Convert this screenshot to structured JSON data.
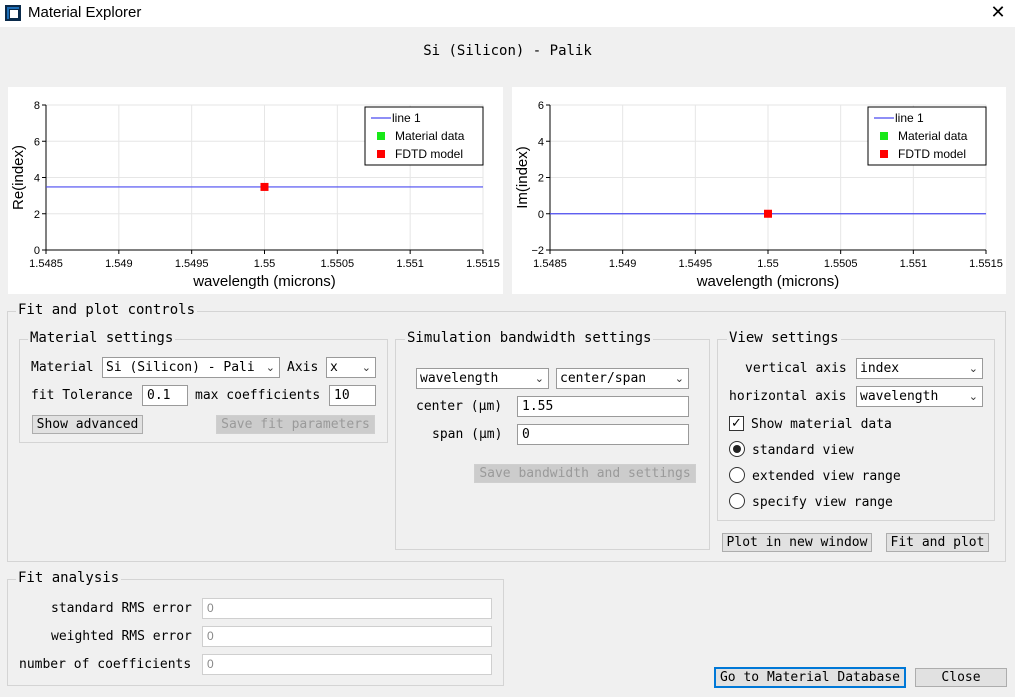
{
  "window": {
    "title": "Material Explorer",
    "close_icon": "close-icon",
    "app_icon": "material-explorer-icon"
  },
  "plot_title": "Si (Silicon) - Palik",
  "chart_data": [
    {
      "type": "line",
      "xlabel": "wavelength (microns)",
      "ylabel": "Re(index)",
      "xlim": [
        1.5485,
        1.5515
      ],
      "ylim": [
        0,
        8
      ],
      "x_ticks": [
        "1.5485",
        "1.549",
        "1.5495",
        "1.55",
        "1.5505",
        "1.551",
        "1.5515"
      ],
      "y_ticks": [
        "0",
        "2",
        "4",
        "6",
        "8"
      ],
      "grid": true,
      "legend": {
        "placement": "top-right",
        "entries": [
          "line 1",
          "Material data",
          "FDTD model"
        ]
      },
      "series": [
        {
          "name": "line 1",
          "x": [
            1.5485,
            1.5515
          ],
          "y": [
            3.48,
            3.48
          ],
          "color": "#4a4af0"
        },
        {
          "name": "Material data",
          "x": [],
          "y": [],
          "color": "#18e818"
        },
        {
          "name": "FDTD model",
          "x": [
            1.55
          ],
          "y": [
            3.48
          ],
          "color": "#ff0000"
        }
      ]
    },
    {
      "type": "line",
      "xlabel": "wavelength (microns)",
      "ylabel": "Im(index)",
      "xlim": [
        1.5485,
        1.5515
      ],
      "ylim": [
        -2,
        6
      ],
      "x_ticks": [
        "1.5485",
        "1.549",
        "1.5495",
        "1.55",
        "1.5505",
        "1.551",
        "1.5515"
      ],
      "y_ticks": [
        "−2",
        "0",
        "2",
        "4",
        "6"
      ],
      "grid": true,
      "legend": {
        "placement": "top-right",
        "entries": [
          "line 1",
          "Material data",
          "FDTD model"
        ]
      },
      "series": [
        {
          "name": "line 1",
          "x": [
            1.5485,
            1.5515
          ],
          "y": [
            0,
            0
          ],
          "color": "#4a4af0"
        },
        {
          "name": "Material data",
          "x": [],
          "y": [],
          "color": "#18e818"
        },
        {
          "name": "FDTD model",
          "x": [
            1.55
          ],
          "y": [
            0
          ],
          "color": "#ff0000"
        }
      ]
    }
  ],
  "fit_plot": {
    "label": "Fit and plot controls",
    "material_settings": {
      "label": "Material settings",
      "material_label": "Material",
      "material_value": "Si (Silicon) - Pali",
      "axis_label": "Axis",
      "axis_value": "x",
      "fit_tolerance_label": "fit Tolerance",
      "fit_tolerance_value": "0.1",
      "max_coefficients_label": "max coefficients",
      "max_coefficients_value": "10",
      "show_advanced": "Show advanced",
      "save_fit": "Save fit parameters"
    },
    "bandwidth": {
      "label": "Simulation bandwidth settings",
      "unit_value": "wavelength",
      "mode_value": "center/span",
      "center_label": "center (μm)",
      "center_value": "1.55",
      "span_label": "span (μm)",
      "span_value": "0",
      "save": "Save bandwidth and settings"
    },
    "view": {
      "label": "View settings",
      "vertical_label": "vertical axis",
      "vertical_value": "index",
      "horizontal_label": "horizontal axis",
      "horizontal_value": "wavelength",
      "show_material": "Show material data",
      "show_material_checked": true,
      "standard": "standard view",
      "extended": "extended view range",
      "specify": "specify view range",
      "selected": "standard"
    },
    "plot_new_window": "Plot in new window",
    "fit_and_plot": "Fit and plot"
  },
  "fit_analysis": {
    "label": "Fit analysis",
    "standard_rms_label": "standard RMS error",
    "standard_rms_value": "0",
    "weighted_rms_label": "weighted RMS error",
    "weighted_rms_value": "0",
    "num_coeff_label": "number of coefficients",
    "num_coeff_value": "0"
  },
  "footer": {
    "go_database": "Go to Material Database",
    "close": "Close"
  }
}
